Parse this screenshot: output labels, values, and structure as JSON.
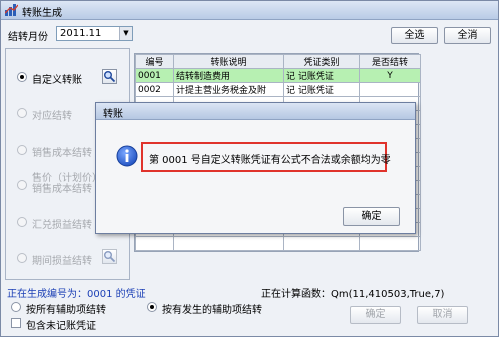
{
  "window": {
    "title": "转账生成"
  },
  "period": {
    "label": "结转月份",
    "value": "2011.11"
  },
  "toolbar": {
    "select_all": "全选",
    "clear_all": "全消"
  },
  "left_options": [
    {
      "label": "自定义转账",
      "selected": true,
      "enabled": true
    },
    {
      "label": "对应结转",
      "selected": false,
      "enabled": false
    },
    {
      "label": "销售成本结转",
      "selected": false,
      "enabled": false
    },
    {
      "label": "售价（计划价）\n销售成本结转",
      "selected": false,
      "enabled": false
    },
    {
      "label": "汇兑损益结转",
      "selected": false,
      "enabled": false
    },
    {
      "label": "期间损益结转",
      "selected": false,
      "enabled": false
    }
  ],
  "table": {
    "columns": [
      "编号",
      "转账说明",
      "凭证类别",
      "是否结转"
    ],
    "rows": [
      {
        "id": "0001",
        "desc": "结转制造费用",
        "voucher": "记 记账凭证",
        "transfer": "Y"
      },
      {
        "id": "0002",
        "desc": "计提主营业务税金及附",
        "voucher": "记 记账凭证",
        "transfer": ""
      }
    ]
  },
  "status": {
    "generating": "正在生成编号为：0001 的凭证",
    "computing": "正在计算函数：Qm(11,410503,True,7)"
  },
  "bottom_options": {
    "all_aux": "按所有辅助项结转",
    "occurred_aux": "按有发生的辅助项结转",
    "include_unposted": "包含未记账凭证"
  },
  "footer_buttons": {
    "ok": "确定",
    "cancel": "取消"
  },
  "dialog": {
    "title": "转账",
    "message": "第 0001 号自定义转账凭证有公式不合法或余额均为零",
    "ok": "确定"
  },
  "colors": {
    "highlight_row": "#b7f0b2",
    "status_text": "#1b3fb5",
    "message_border": "#e0332c"
  }
}
